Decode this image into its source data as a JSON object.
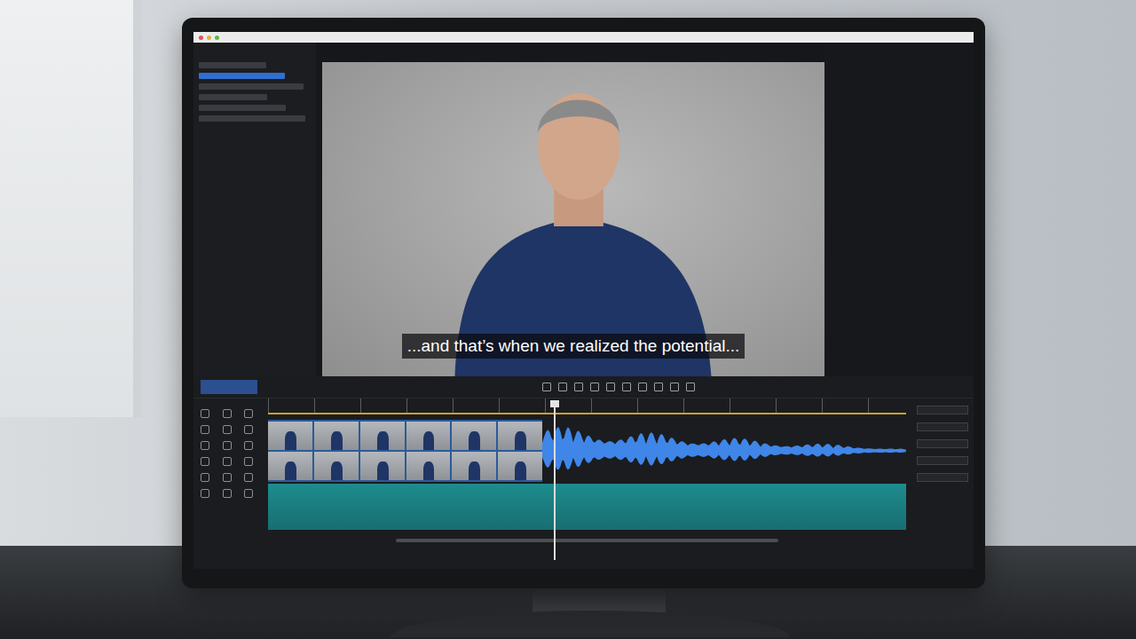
{
  "preview": {
    "caption": "...and that’s when we realized the potential..."
  },
  "timeline": {
    "playhead": 0.445
  }
}
